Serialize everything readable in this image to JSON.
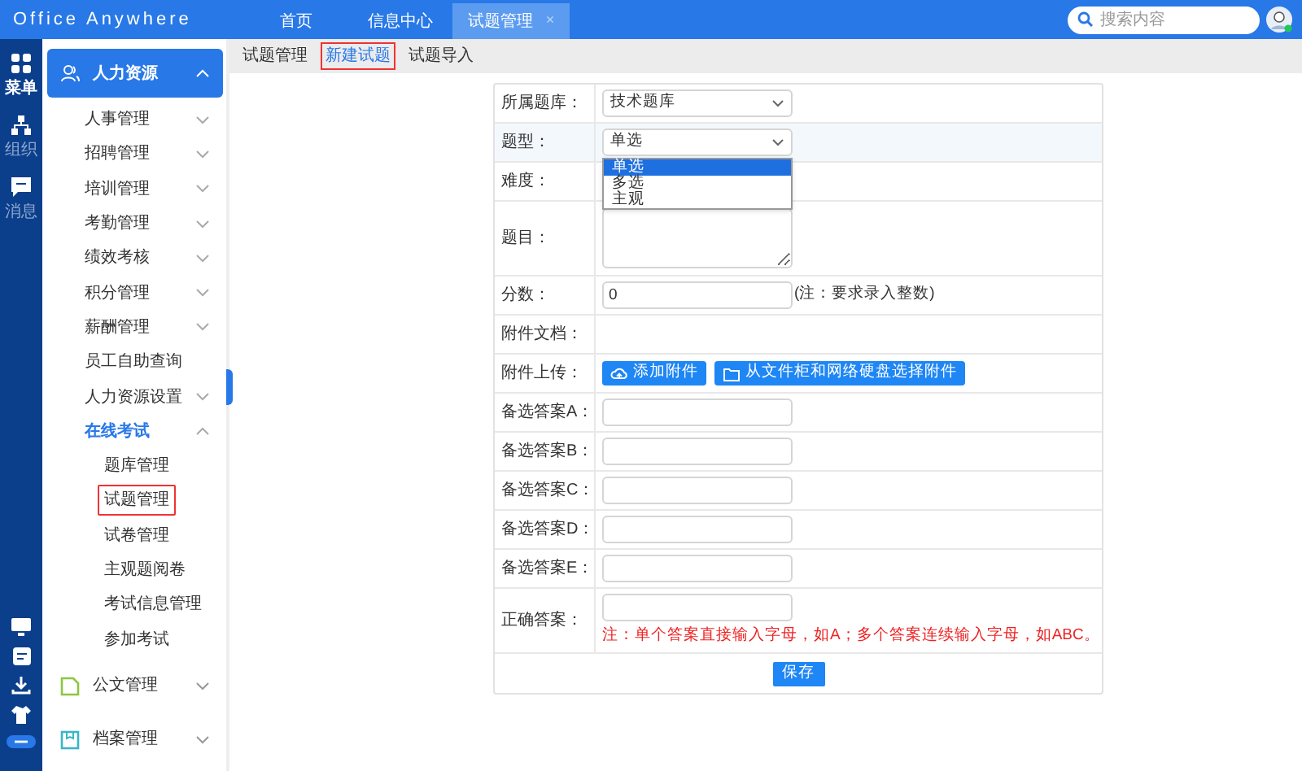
{
  "logo": "Office Anywhere",
  "tabs": [
    {
      "label": "首页",
      "selected": false
    },
    {
      "label": "信息中心",
      "selected": false
    },
    {
      "label": "试题管理",
      "selected": true,
      "close": "×"
    }
  ],
  "search": {
    "placeholder": "搜索内容"
  },
  "rail": {
    "items": [
      {
        "label": "菜单",
        "selected": true
      },
      {
        "label": "组织",
        "selected": false
      },
      {
        "label": "消息",
        "selected": false
      }
    ]
  },
  "sidebar": {
    "groups": [
      {
        "label": "人力资源",
        "expanded": true,
        "selected": true,
        "children": [
          {
            "label": "人事管理",
            "expanded": false
          },
          {
            "label": "招聘管理",
            "expanded": false
          },
          {
            "label": "培训管理",
            "expanded": false
          },
          {
            "label": "考勤管理",
            "expanded": false
          },
          {
            "label": "绩效考核",
            "expanded": false
          },
          {
            "label": "积分管理",
            "expanded": false
          },
          {
            "label": "薪酬管理",
            "expanded": false
          },
          {
            "label": "员工自助查询"
          },
          {
            "label": "人力资源设置",
            "expanded": false
          },
          {
            "label": "在线考试",
            "expanded": true,
            "children": [
              {
                "label": "题库管理",
                "selected": false
              },
              {
                "label": "试题管理",
                "selected": true
              },
              {
                "label": "试卷管理",
                "selected": false
              },
              {
                "label": "主观题阅卷",
                "selected": false
              },
              {
                "label": "考试信息管理",
                "selected": false
              },
              {
                "label": "参加考试",
                "selected": false
              }
            ]
          }
        ]
      },
      {
        "label": "公文管理",
        "expanded": false,
        "selected": false
      },
      {
        "label": "档案管理",
        "expanded": false,
        "selected": false
      }
    ]
  },
  "subtabs": [
    {
      "label": "试题管理",
      "selected": false
    },
    {
      "label": "新建试题",
      "selected": true
    },
    {
      "label": "试题导入",
      "selected": false
    }
  ],
  "form": {
    "rows": [
      {
        "kind": "select",
        "label": "所属题库：",
        "value": "技术题库"
      },
      {
        "kind": "select",
        "label": "题型：",
        "value": "单选",
        "highlighted": true,
        "open": true,
        "options": [
          {
            "label": "单选",
            "selected": true
          },
          {
            "label": "多选",
            "selected": false
          },
          {
            "label": "主观",
            "selected": false
          }
        ]
      },
      {
        "kind": "empty",
        "label": "难度："
      },
      {
        "kind": "textarea",
        "label": "题目："
      },
      {
        "kind": "input",
        "label": "分数：",
        "value": "0",
        "note": "(注：要求录入整数)"
      },
      {
        "kind": "empty",
        "label": "附件文档："
      },
      {
        "kind": "buttons",
        "label": "附件上传：",
        "buttons": [
          {
            "label": "添加附件"
          },
          {
            "label": "从文件柜和网络硬盘选择附件"
          }
        ]
      },
      {
        "kind": "input",
        "label": "备选答案A："
      },
      {
        "kind": "input",
        "label": "备选答案B："
      },
      {
        "kind": "input",
        "label": "备选答案C："
      },
      {
        "kind": "input",
        "label": "备选答案D："
      },
      {
        "kind": "input",
        "label": "备选答案E："
      },
      {
        "kind": "input",
        "label": "正确答案：",
        "warning": "注：单个答案直接输入字母，如A；多个答案连续输入字母，如ABC。"
      }
    ],
    "save": "保存"
  }
}
